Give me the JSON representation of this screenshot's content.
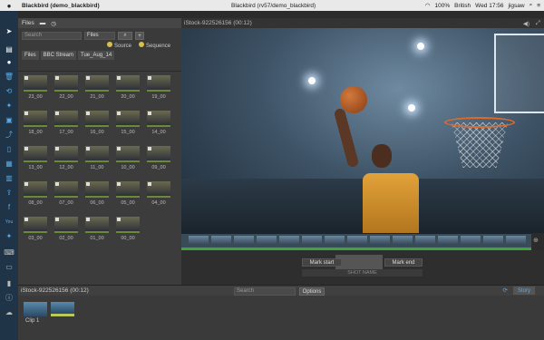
{
  "menubar": {
    "app_title": "Blackbird (demo_blackbird)",
    "window_title": "Blackbird (rv57/demo_blackbird)",
    "battery": "100%",
    "locale": "British",
    "clock": "Wed 17:56",
    "user": "jigsaw"
  },
  "filepanel": {
    "title": "Files",
    "search_placeholder": "Search",
    "filter_value": "Files",
    "source_label": "Source",
    "sequence_label": "Sequence",
    "tabs": [
      "Files",
      "BBC Stream",
      "Tue_Aug_14"
    ],
    "thumbnails": [
      "23_00",
      "22_00",
      "21_00",
      "20_00",
      "19_00",
      "18_00",
      "17_00",
      "16_00",
      "15_00",
      "14_00",
      "13_00",
      "12_00",
      "11_00",
      "10_00",
      "09_00",
      "08_00",
      "07_00",
      "06_00",
      "05_00",
      "04_00",
      "03_00",
      "02_00",
      "01_00",
      "00_00"
    ]
  },
  "viewer": {
    "title": "iStock-922526156 (00:12)",
    "mark_start": "Mark start",
    "mark_end": "Mark end",
    "shot_name_placeholder": "SHOT NAME"
  },
  "bottom": {
    "title": "iStock-922526156 (00:12)",
    "search_placeholder": "Search",
    "options_label": "Options",
    "story_label": "Story",
    "clips": [
      "Clip 1"
    ]
  },
  "colors": {
    "accent": "#5aa9e6",
    "timeline_green": "#3ea33e",
    "checkbox_yellow": "#d8c04b"
  }
}
